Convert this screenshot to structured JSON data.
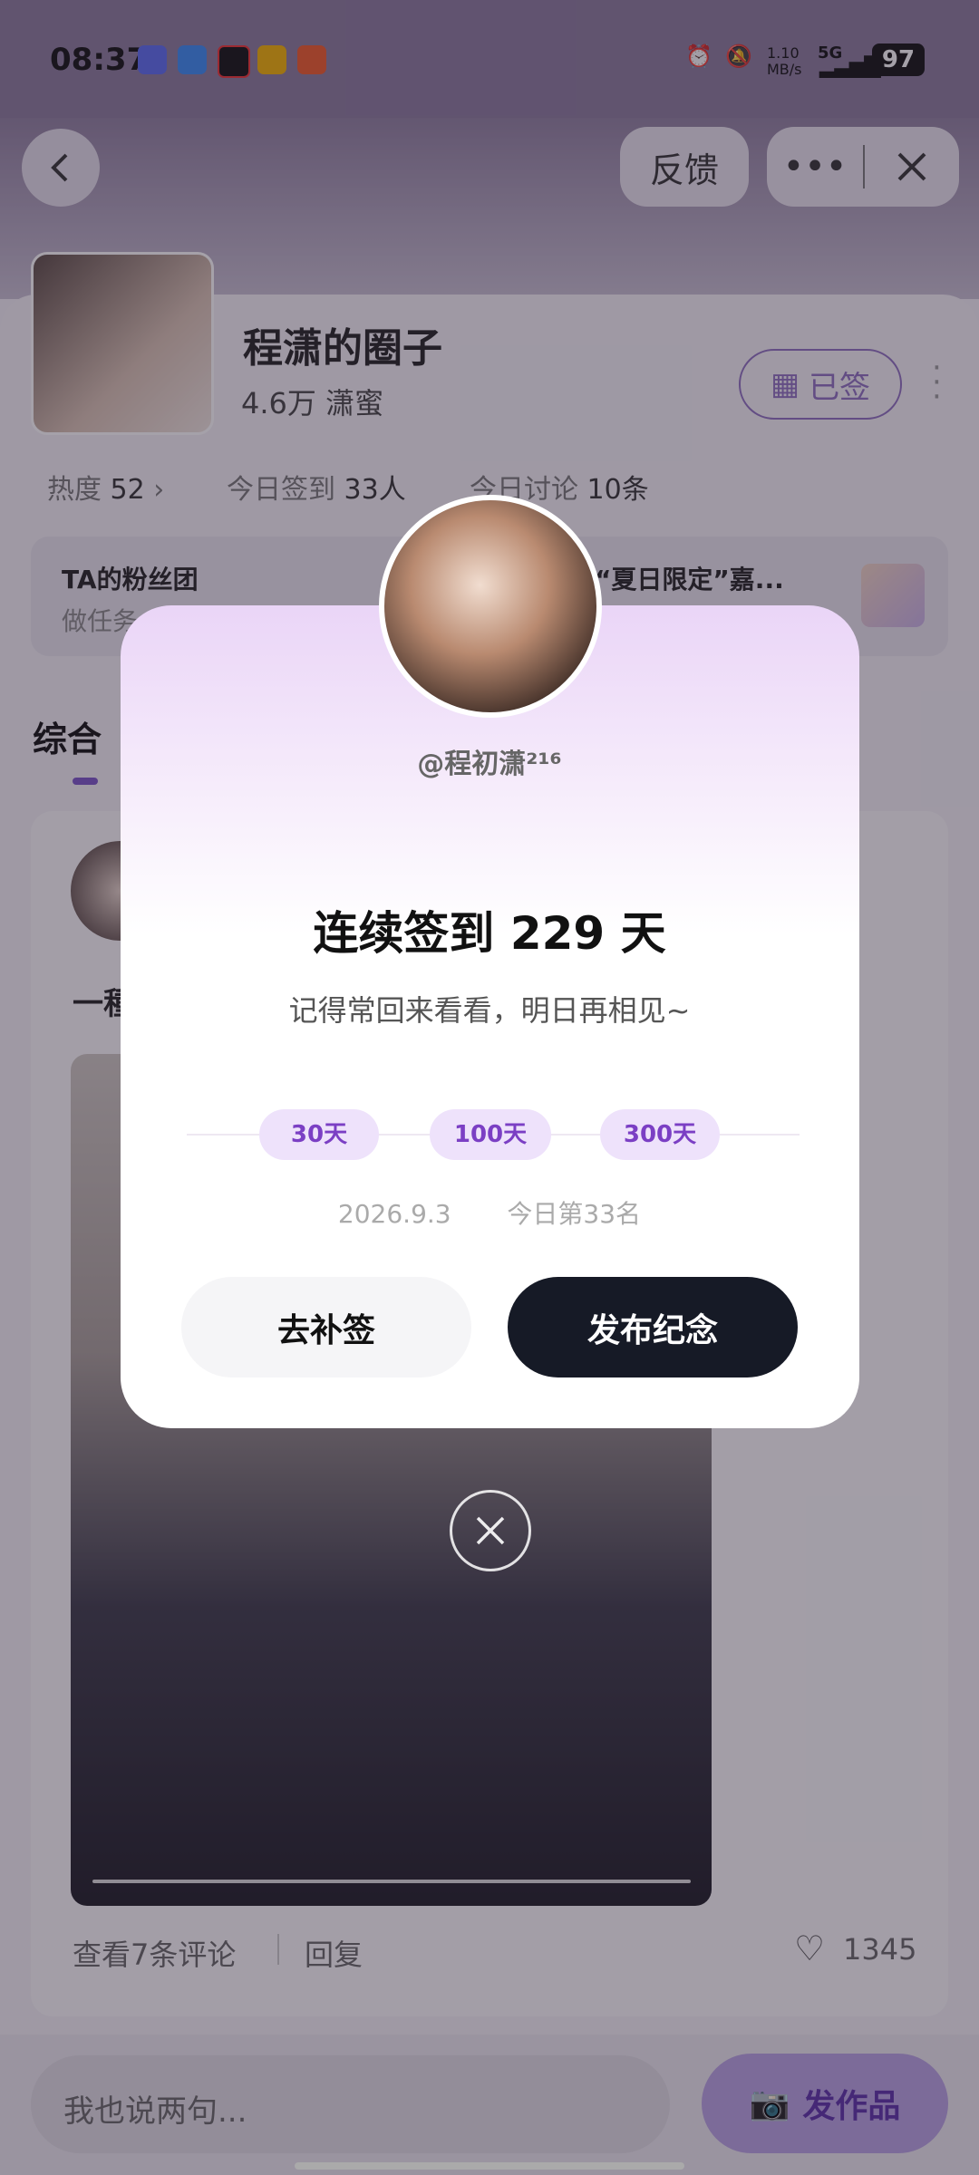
{
  "status": {
    "time": "08:37",
    "net_speed": "1.10 MB/s",
    "network": "5G",
    "battery": "97"
  },
  "header": {
    "feedback": "反馈"
  },
  "group": {
    "title": "程潇的圈子",
    "members": "4.6万 潇蜜",
    "signed": "已签",
    "heat_label": "热度",
    "heat_value": "52",
    "checkin_label": "今日签到",
    "checkin_value": "33人",
    "discuss_label": "今日讨论",
    "discuss_value": "10条"
  },
  "fan_card": {
    "title": "TA的粉丝团",
    "sub": "做任务",
    "event": "“夏日限定”嘉..."
  },
  "tabs": {
    "first": "综合"
  },
  "post": {
    "text": "一種",
    "comments": "查看7条评论",
    "reply": "回复",
    "likes": "1345"
  },
  "bottom": {
    "placeholder": "我也说两句...",
    "publish": "发作品"
  },
  "modal": {
    "username": "@程初潇²¹⁶",
    "streak": "连续签到 229 天",
    "subtitle": "记得常回来看看，明日再相见~",
    "milestones": [
      "30天",
      "100天",
      "300天"
    ],
    "date": "2026.9.3",
    "rank": "今日第33名",
    "makeup_btn": "去补签",
    "publish_btn": "发布纪念"
  },
  "colors": {
    "accent": "#7b55c9",
    "dark_button": "#161a26"
  }
}
